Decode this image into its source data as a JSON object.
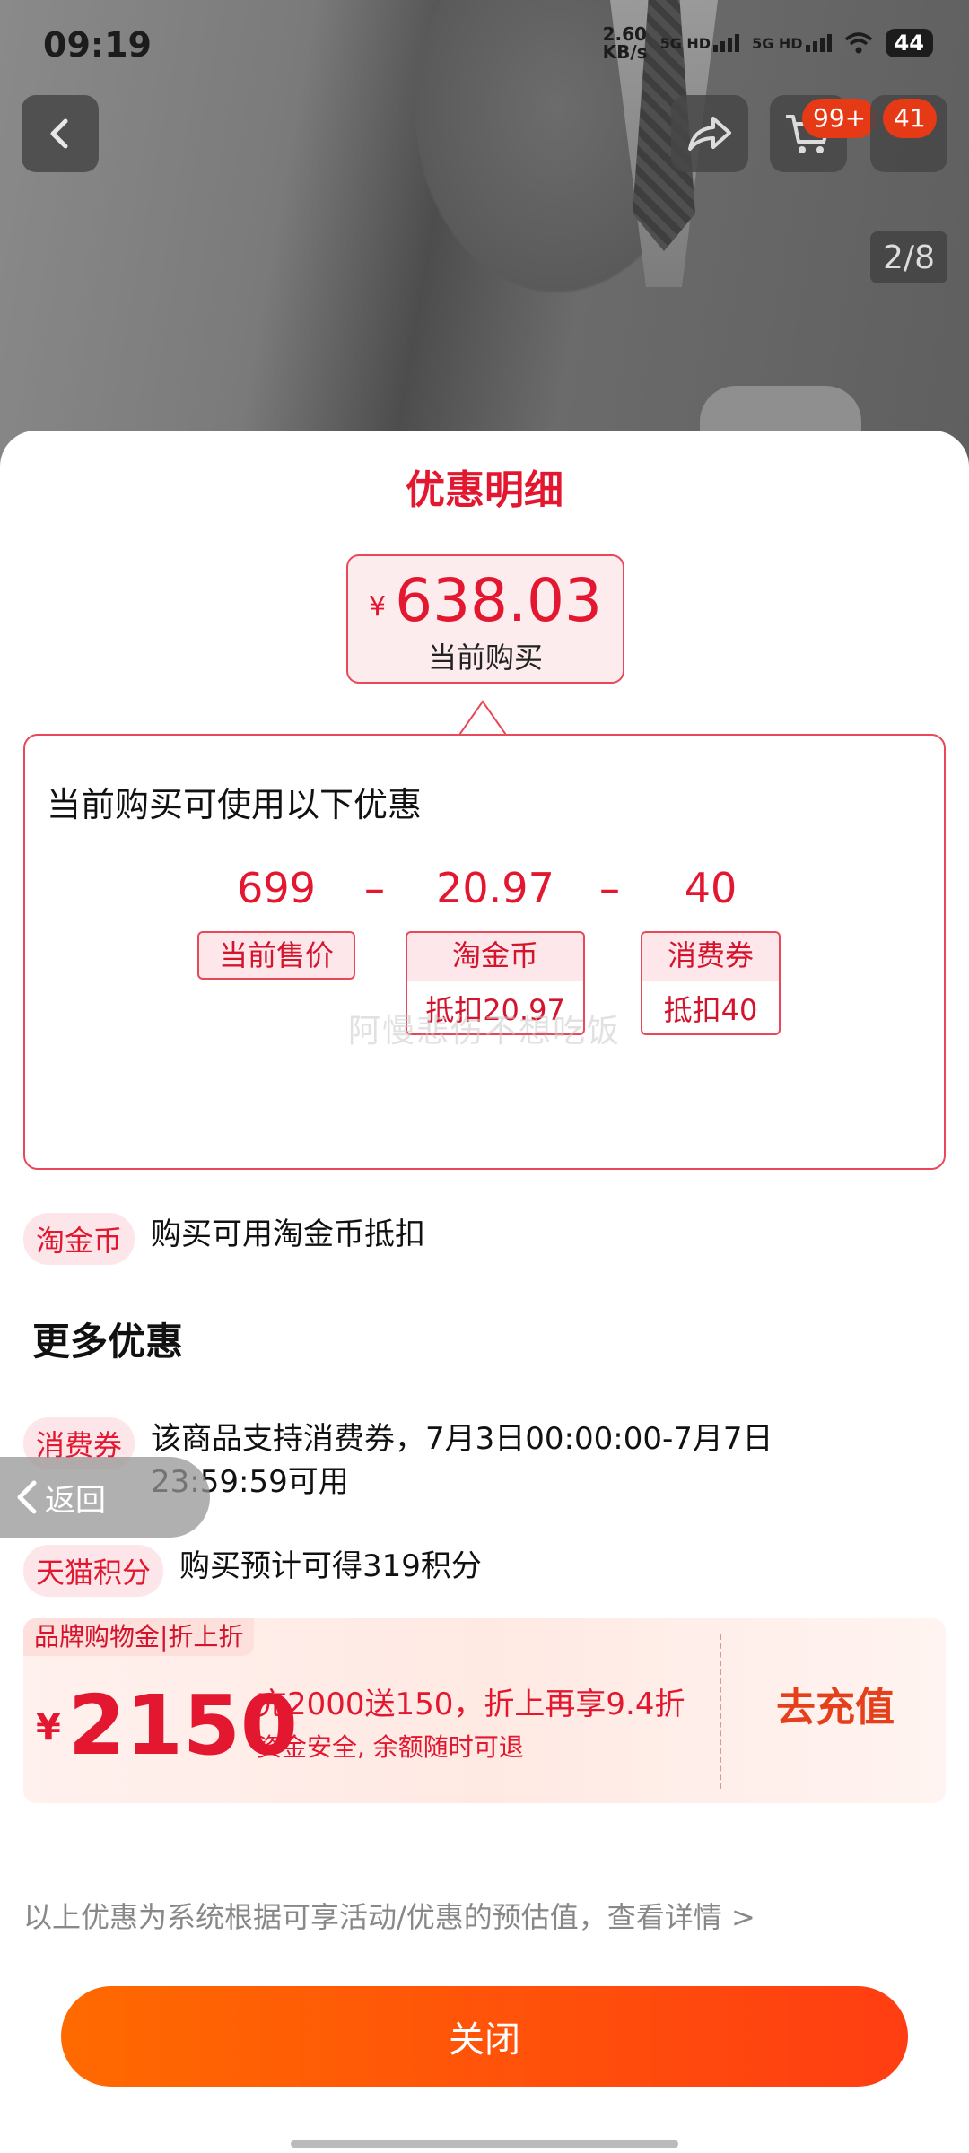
{
  "status": {
    "time": "09:19",
    "net_speed_value": "2.60",
    "net_speed_unit": "KB/s",
    "sim1": "5G HD",
    "sim2": "5G HD",
    "battery": "44"
  },
  "header": {
    "cart_badge": "99+",
    "message_badge": "41",
    "page_indicator": "2/8"
  },
  "sheet": {
    "title": "优惠明细",
    "current": {
      "currency": "¥",
      "price": "638.03",
      "label": "当前购买"
    },
    "calc": {
      "heading": "当前购买可使用以下优惠",
      "minus": "–",
      "items": [
        {
          "value": "699",
          "tag": "当前售价"
        },
        {
          "value": "20.97",
          "tag": "淘金币",
          "sub": "抵扣20.97"
        },
        {
          "value": "40",
          "tag": "消费券",
          "sub": "抵扣40"
        }
      ]
    },
    "watermark": "阿慢悲伤不想吃饭",
    "taojinbi": {
      "pill": "淘金币",
      "text": "购买可用淘金币抵扣"
    },
    "more_title": "更多优惠",
    "coupon": {
      "pill": "消费券",
      "text": "该商品支持消费券，7月3日00:00:00-7月7日23:59:59可用"
    },
    "points": {
      "pill": "天猫积分",
      "text": "购买预计可得319积分"
    },
    "back_label": "返回",
    "promo": {
      "tag": "品牌购物金|折上折",
      "currency": "¥",
      "amount": "2150",
      "line1": "充2000送150，折上再享9.4折",
      "line2": "资金安全, 余额随时可退",
      "button": "去充值"
    },
    "disclaimer": "以上优惠为系统根据可享活动/优惠的预估值，查看详情 >",
    "close_button": "关闭"
  },
  "colors": {
    "accent_red": "#e3172f",
    "orange_start": "#ff6a00",
    "orange_end": "#ff3d12"
  },
  "icons": [
    "back-arrow-icon",
    "share-icon",
    "cart-icon",
    "message-icon",
    "wifi-icon",
    "chevron-left-icon"
  ]
}
